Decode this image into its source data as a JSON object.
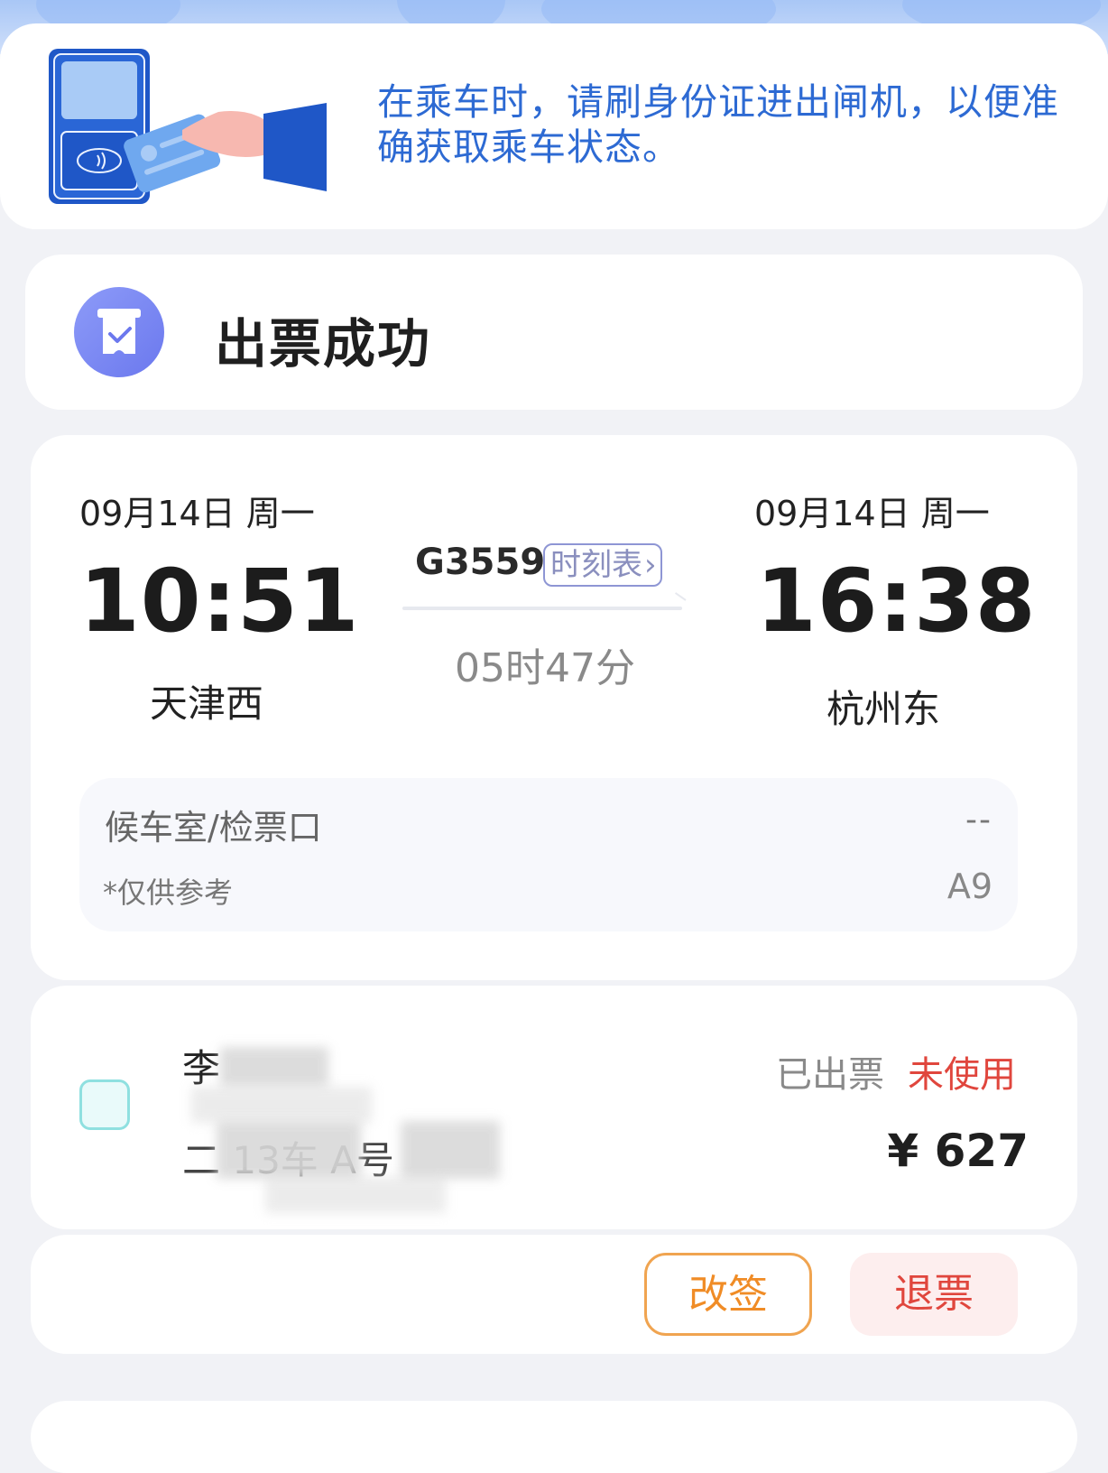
{
  "notice": {
    "text": "在乘车时，请刷身份证进出闸机，以便准确获取乘车状态。",
    "icon": "id-card-gate-illustration"
  },
  "status": {
    "title": "出票成功",
    "icon": "ticket-check-icon"
  },
  "trip": {
    "departure": {
      "date": "09月14日 周一",
      "time": "10:51",
      "station": "天津西"
    },
    "arrival": {
      "date": "09月14日 周一",
      "time": "16:38",
      "station": "杭州东"
    },
    "train_no": "G3559",
    "timetable_label": "时刻表",
    "duration": "05时47分",
    "waiting": {
      "label": "候车室/检票口",
      "value": "--",
      "note": "*仅供参考",
      "gate": "A9"
    }
  },
  "passenger": {
    "name": "李",
    "seat": "二 13车 A号",
    "ticket_status": "已出票",
    "use_status": "未使用",
    "price": "¥ 627"
  },
  "actions": {
    "change_label": "改签",
    "refund_label": "退票"
  },
  "colors": {
    "accent_blue": "#2d6ad3",
    "status_purple": "#6b78ee",
    "alert_red": "#e0463d",
    "change_orange": "#f08c26"
  }
}
